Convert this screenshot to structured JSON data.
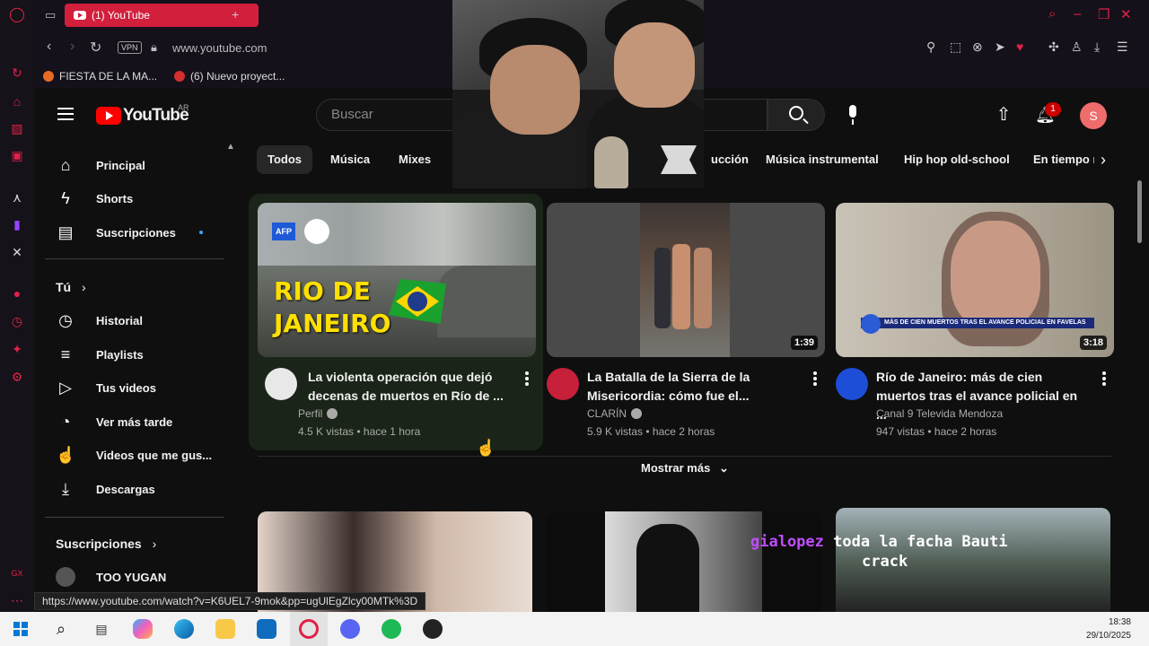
{
  "browser": {
    "tab_title": "(1) YouTube",
    "vpn_label": "VPN",
    "url": "www.youtube.com",
    "bookmarks": [
      "FIESTA DE LA MA...",
      "(6) Nuevo proyect..."
    ],
    "status_url": "https://www.youtube.com/watch?v=K6UEL7-9mok&pp=ugUlEgZlcy00MTk%3D"
  },
  "header": {
    "logo_text": "YouTube",
    "country": "AR",
    "search_placeholder": "Buscar",
    "notification_count": "1",
    "avatar_letter": "S"
  },
  "sidebar": {
    "main": [
      {
        "label": "Principal",
        "icon": "home-icon"
      },
      {
        "label": "Shorts",
        "icon": "shorts-icon"
      },
      {
        "label": "Suscripciones",
        "icon": "subscriptions-icon"
      }
    ],
    "you_title": "Tú",
    "you_items": [
      {
        "label": "Historial",
        "icon": "history-icon"
      },
      {
        "label": "Playlists",
        "icon": "playlists-icon"
      },
      {
        "label": "Tus videos",
        "icon": "your-videos-icon"
      },
      {
        "label": "Ver más tarde",
        "icon": "watch-later-icon"
      },
      {
        "label": "Videos que me gus...",
        "icon": "liked-icon"
      },
      {
        "label": "Descargas",
        "icon": "downloads-icon"
      }
    ],
    "subs_title": "Suscripciones",
    "subs_items": [
      {
        "label": "TOO YUGAN"
      }
    ]
  },
  "chips": [
    "Todos",
    "Música",
    "Mixes",
    "ucción",
    "Música instrumental",
    "Hip hop old-school",
    "En tiempo r"
  ],
  "videos": [
    {
      "title": "La violenta operación que dejó decenas de muertos en Río de ...",
      "channel": "Perfil",
      "meta": "4.5 K vistas • hace 1 hora",
      "thumb_text_1": "RIO DE",
      "thumb_text_2": "JANEIRO",
      "thumb_tag": "AFP"
    },
    {
      "title": "La Batalla de la Sierra de la Misericordia: cómo fue el...",
      "channel": "CLARÍN",
      "meta": "5.9 K vistas • hace 2 horas",
      "duration": "1:39"
    },
    {
      "title": "Río de Janeiro: más de cien muertos tras el avance policial en ...",
      "channel": "Canal 9 Televida Mendoza",
      "meta": "947 vistas • hace 2 horas",
      "duration": "3:18",
      "thumb_caption": "MÁS DE CIEN MUERTOS TRAS EL AVANCE POLICIAL EN FAVELAS"
    }
  ],
  "show_more": "Mostrar más",
  "chat": {
    "user": "gialopez",
    "message_1": "toda la facha Bauti",
    "message_2": "crack"
  },
  "taskbar": {
    "time": "18:38",
    "date": "29/10/2025"
  },
  "colors": {
    "accent": "#d21f3c",
    "yt_red": "#ff0000",
    "chat_user": "#b84dff"
  }
}
